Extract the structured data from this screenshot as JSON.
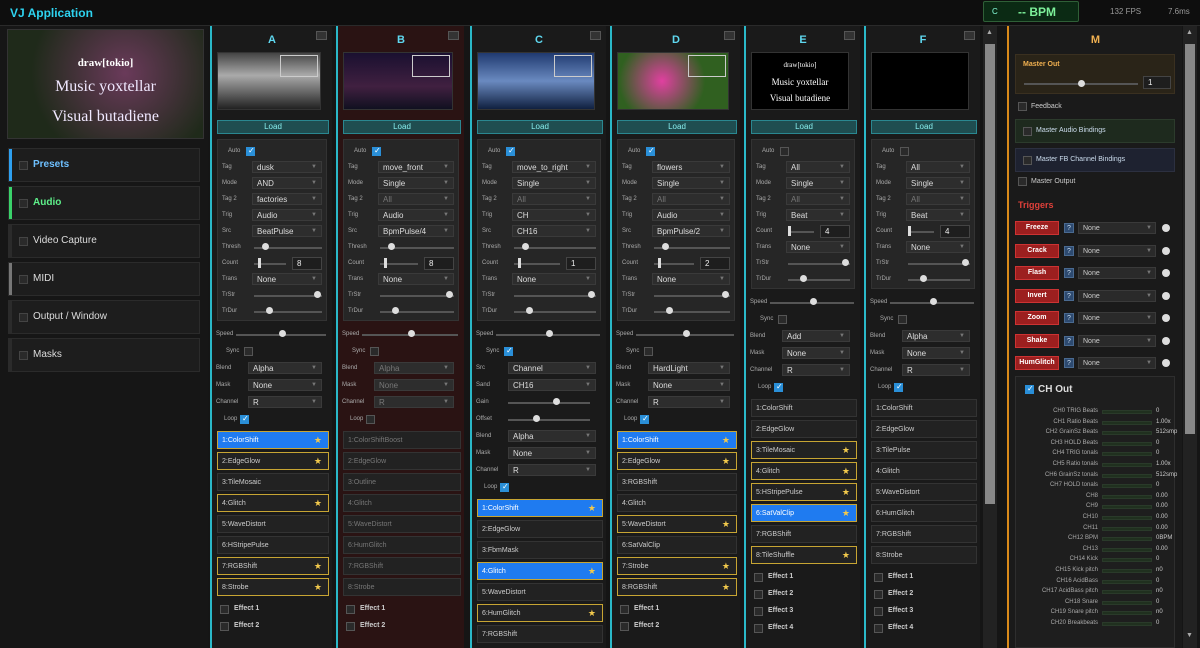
{
  "app": {
    "title": "VJ Application",
    "bpm_key": "C",
    "bpm": "-- BPM",
    "fps": "132 FPS",
    "ms": "7.6ms"
  },
  "preview": {
    "logo": "draw[tokio]",
    "line1": "Music yoxtellar",
    "line2": "Visual butadiene"
  },
  "left_items": [
    {
      "label": "Presets",
      "color": "#2ea0f0",
      "text_color": "#6ec0ff"
    },
    {
      "label": "Audio",
      "color": "#3ad26a",
      "text_color": "#5ef08a"
    },
    {
      "label": "Video Capture",
      "color": "#2b2b2b",
      "text_color": "#dddddd"
    },
    {
      "label": "MIDI",
      "color": "#777777",
      "text_color": "#dddddd"
    },
    {
      "label": "Output / Window",
      "color": "#2b2b2b",
      "text_color": "#dddddd"
    },
    {
      "label": "Masks",
      "color": "#2b2b2b",
      "text_color": "#dddddd"
    }
  ],
  "labels": {
    "load": "Load",
    "auto": "Auto",
    "tag": "Tag",
    "mode": "Mode",
    "tag2": "Tag 2",
    "trig": "Trig",
    "src": "Src",
    "thresh": "Thresh",
    "count": "Count",
    "trans": "Trans",
    "trstr": "TrStr",
    "trdur": "TrDur",
    "speed": "Speed",
    "sync": "Sync",
    "blend": "Blend",
    "mask": "Mask",
    "channel": "Channel",
    "loop": "Loop",
    "sand": "Sand",
    "gain": "Gain",
    "offset": "Offset"
  },
  "columns": [
    {
      "name": "A",
      "tag": "dusk",
      "mode": "AND",
      "tag2": "factories",
      "trig": "Audio",
      "src": "BeatPulse",
      "count": "8",
      "trans": "None",
      "blend": "Alpha",
      "mask": "None",
      "channel": "R",
      "effects": [
        "1:ColorShift",
        "2:EdgeGlow",
        "3:TileMosaic",
        "4:Glitch",
        "5:WaveDistort",
        "6:HStripePulse",
        "7:RGBShift",
        "8:Strobe"
      ],
      "active": [
        0
      ],
      "star": [
        0,
        1,
        3,
        6,
        7
      ],
      "extra": [
        "Effect 1",
        "Effect 2"
      ]
    },
    {
      "name": "B",
      "tag": "move_front",
      "mode": "Single",
      "tag2": "All",
      "trig": "Audio",
      "src": "BpmPulse/4",
      "count": "8",
      "trans": "None",
      "blend": "Alpha",
      "mask": "None",
      "channel": "R",
      "effects": [
        "1:ColorShiftBoost",
        "2:EdgeGlow",
        "3:Outline",
        "4:Glitch",
        "5:WaveDistort",
        "6:HumGlitch",
        "7:RGBShift",
        "8:Strobe"
      ],
      "active": [],
      "star": [],
      "extra": [
        "Effect 1",
        "Effect 2"
      ]
    },
    {
      "name": "C",
      "tag": "move_to_right",
      "mode": "Single",
      "tag2": "All",
      "trig": "CH",
      "src": "CH16",
      "count": "1",
      "trans": "None",
      "blend": "Alpha",
      "mask": "None",
      "channel": "R",
      "csrc": "Channel",
      "sand": "CH16",
      "effects": [
        "1:ColorShift",
        "2:EdgeGlow",
        "3:FbmMask",
        "4:Glitch",
        "5:WaveDistort",
        "6:HumGlitch",
        "7:RGBShift"
      ],
      "active": [
        0,
        3
      ],
      "star": [
        0,
        3,
        5
      ],
      "extra": []
    },
    {
      "name": "D",
      "tag": "flowers",
      "mode": "Single",
      "tag2": "All",
      "trig": "Audio",
      "src": "BpmPulse/2",
      "count": "2",
      "trans": "None",
      "blend": "HardLight",
      "mask": "None",
      "channel": "R",
      "effects": [
        "1:ColorShift",
        "2:EdgeGlow",
        "3:RGBShift",
        "4:Glitch",
        "5:WaveDistort",
        "6:SatValClip",
        "7:Strobe",
        "8:RGBShift"
      ],
      "active": [
        0
      ],
      "star": [
        0,
        1,
        4,
        6,
        7
      ],
      "extra": [
        "Effect 1",
        "Effect 2"
      ]
    },
    {
      "name": "E",
      "tag": "All",
      "mode": "Single",
      "tag2": "All",
      "trig": "Beat",
      "count": "4",
      "trans": "None",
      "blend": "Add",
      "mask": "None",
      "channel": "R",
      "logo": "draw[tokio]",
      "line1": "Music yoxtellar",
      "line2": "Visual butadiene",
      "effects": [
        "1:ColorShift",
        "2:EdgeGlow",
        "3:TileMosaic",
        "4:Glitch",
        "5:HStripePulse",
        "6:SatValClip",
        "7:RGBShift",
        "8:TileShuffle"
      ],
      "active": [
        5
      ],
      "star": [
        2,
        3,
        4,
        5,
        7
      ],
      "extra": [
        "Effect 1",
        "Effect 2",
        "Effect 3",
        "Effect 4"
      ]
    },
    {
      "name": "F",
      "tag": "All",
      "mode": "Single",
      "tag2": "All",
      "trig": "Beat",
      "count": "4",
      "trans": "None",
      "blend": "Alpha",
      "mask": "None",
      "channel": "R",
      "effects": [
        "1:ColorShift",
        "2:EdgeGlow",
        "3:TilePulse",
        "4:Glitch",
        "5:WaveDistort",
        "6:HumGlitch",
        "7:RGBShift",
        "8:Strobe"
      ],
      "active": [],
      "star": [],
      "extra": [
        "Effect 1",
        "Effect 2",
        "Effect 3",
        "Effect 4"
      ]
    }
  ],
  "master": {
    "title": "M",
    "master_out": "Master Out",
    "master_value": "1",
    "feedback": "Feedback",
    "audio_bind": "Master Audio Bindings",
    "fb_bind": "Master FB Channel Bindings",
    "output": "Master Output",
    "triggers_title": "Triggers",
    "triggers": [
      {
        "name": "Freeze",
        "val": "None"
      },
      {
        "name": "Crack",
        "val": "None"
      },
      {
        "name": "Flash",
        "val": "None"
      },
      {
        "name": "Invert",
        "val": "None"
      },
      {
        "name": "Zoom",
        "val": "None"
      },
      {
        "name": "Shake",
        "val": "None"
      },
      {
        "name": "HumGlitch",
        "val": "None"
      }
    ],
    "ch_out": "CH Out",
    "channels": [
      {
        "n": "CH0 TRIG Beats",
        "v": "0"
      },
      {
        "n": "CH1 Ratio Beats",
        "v": "1.00x"
      },
      {
        "n": "CH2 GrainSz Beats",
        "v": "512smp"
      },
      {
        "n": "CH3 HOLD Beats",
        "v": "0"
      },
      {
        "n": "CH4 TRIG tonals",
        "v": "0"
      },
      {
        "n": "CH5 Ratio tonals",
        "v": "1.00x"
      },
      {
        "n": "CH6 GrainSz tonals",
        "v": "512smp"
      },
      {
        "n": "CH7 HOLD tonals",
        "v": "0"
      },
      {
        "n": "CH8",
        "v": "0.00"
      },
      {
        "n": "CH9",
        "v": "0.00"
      },
      {
        "n": "CH10",
        "v": "0.00"
      },
      {
        "n": "CH11",
        "v": "0.00"
      },
      {
        "n": "CH12 BPM",
        "v": "0BPM"
      },
      {
        "n": "CH13",
        "v": "0.00"
      },
      {
        "n": "CH14 Kick",
        "v": "0"
      },
      {
        "n": "CH15 Kick pitch",
        "v": "n0"
      },
      {
        "n": "CH16 AcidBass",
        "v": "0"
      },
      {
        "n": "CH17 AcidBass pitch",
        "v": "n0"
      },
      {
        "n": "CH18 Snare",
        "v": "0"
      },
      {
        "n": "CH19 Snare pitch",
        "v": "n0"
      },
      {
        "n": "CH20 Breakbeats",
        "v": "0"
      }
    ]
  }
}
